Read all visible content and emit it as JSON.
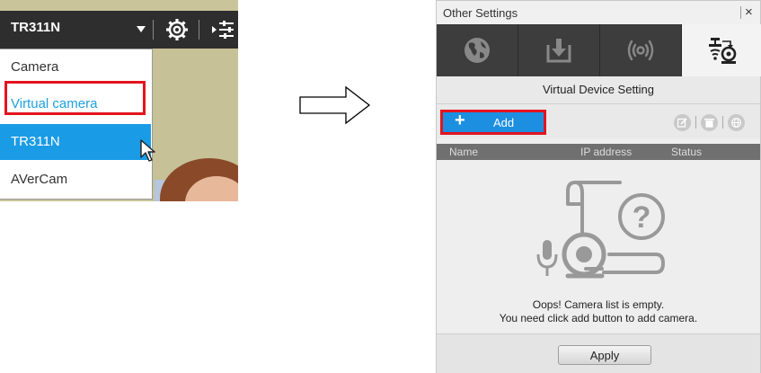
{
  "left_panel": {
    "selected_device": "TR311N",
    "dropdown_items": [
      {
        "label": "Camera"
      },
      {
        "label": "Virtual camera"
      },
      {
        "label": "TR311N"
      },
      {
        "label": "AVerCam"
      }
    ]
  },
  "dialog": {
    "title": "Other Settings",
    "close_glyph": "×",
    "tabs": [
      {
        "icon": "globe-icon"
      },
      {
        "icon": "download-icon"
      },
      {
        "icon": "wireless-broadcast-icon"
      },
      {
        "icon": "network-camera-icon",
        "active": true
      }
    ],
    "section_title": "Virtual Device Setting",
    "add_label": "Add",
    "add_glyph": "+",
    "tool_icons": [
      "edit-icon",
      "delete-icon",
      "globe-icon"
    ],
    "table_columns": [
      "Name",
      "IP address",
      "Status"
    ],
    "empty_title": "Oops! Camera list is empty.",
    "empty_hint": "You need click add button to add camera.",
    "apply_label": "Apply"
  },
  "colors": {
    "highlight_red": "#e3141f",
    "accent_blue": "#1a9be6",
    "virtual_text": "#1ea0e0",
    "tabbar_dark": "#3d3d3d"
  }
}
